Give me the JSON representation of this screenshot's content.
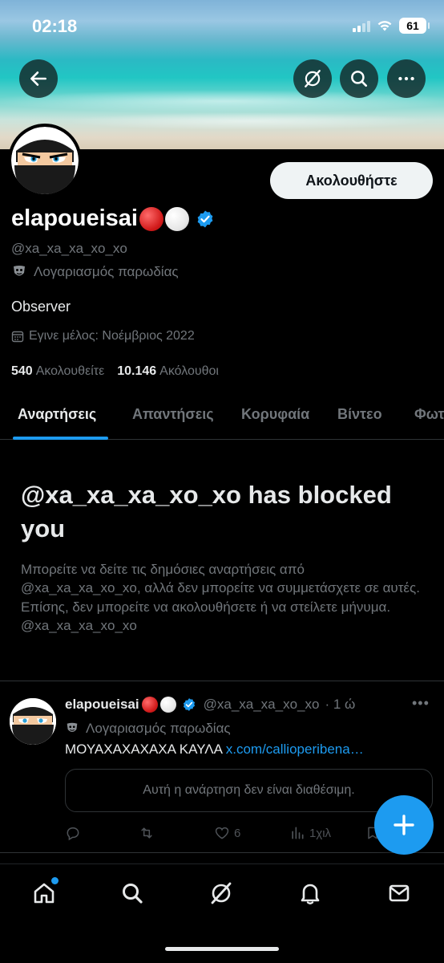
{
  "status_bar": {
    "time": "02:18",
    "battery": "61"
  },
  "profile": {
    "display_name": "elapoueisai",
    "handle": "@xa_xa_xa_xo_xo",
    "parody_label": "Λογαριασμός παρωδίας",
    "bio": "Observer",
    "joined": "Εγινε μέλος: Νοέμβριος 2022",
    "following_count": "540",
    "following_label": "Ακολουθείτε",
    "followers_count": "10.146",
    "followers_label": "Ακόλουθοι",
    "follow_button": "Ακολουθήστε"
  },
  "tabs": [
    {
      "label": "Αναρτήσεις",
      "active": true
    },
    {
      "label": "Απαντήσεις",
      "active": false
    },
    {
      "label": "Κορυφαία",
      "active": false
    },
    {
      "label": "Βίντεο",
      "active": false
    },
    {
      "label": "Φωτ",
      "active": false
    }
  ],
  "blocked": {
    "title": "@xa_xa_xa_xo_xo has blocked you",
    "message": "Μπορείτε να δείτε τις δημόσιες αναρτήσεις από @xa_xa_xa_xo_xo, αλλά δεν μπορείτε να συμμετάσχετε σε αυτές. Επίσης, δεν μπορείτε να ακολουθήσετε ή να στείλετε μήνυμα. @xa_xa_xa_xo_xo"
  },
  "post": {
    "author_name": "elapoueisai",
    "author_handle": "@xa_xa_xa_xo_xo",
    "time": "· 1 ώ",
    "parody_label": "Λογαριασμός παρωδίας",
    "text": "ΜΟΥΑΧΑΧΑΧΑΧΑ ΚΑΥΛΑ",
    "link": "x.com/callioperibena…",
    "quoted_unavailable": "Αυτή η ανάρτηση δεν είναι διαθέσιμη.",
    "likes": "6",
    "views": "1χιλ"
  },
  "colors": {
    "accent": "#1d9bf0",
    "background": "#000000",
    "muted": "#71767b"
  },
  "icons": [
    "back-arrow-icon",
    "grok-icon",
    "search-icon",
    "more-icon",
    "verified-icon",
    "parody-mask-icon",
    "calendar-icon",
    "reply-icon",
    "repost-icon",
    "like-icon",
    "views-icon",
    "bookmark-icon",
    "compose-plus-icon",
    "home-icon",
    "notifications-icon",
    "messages-icon"
  ]
}
